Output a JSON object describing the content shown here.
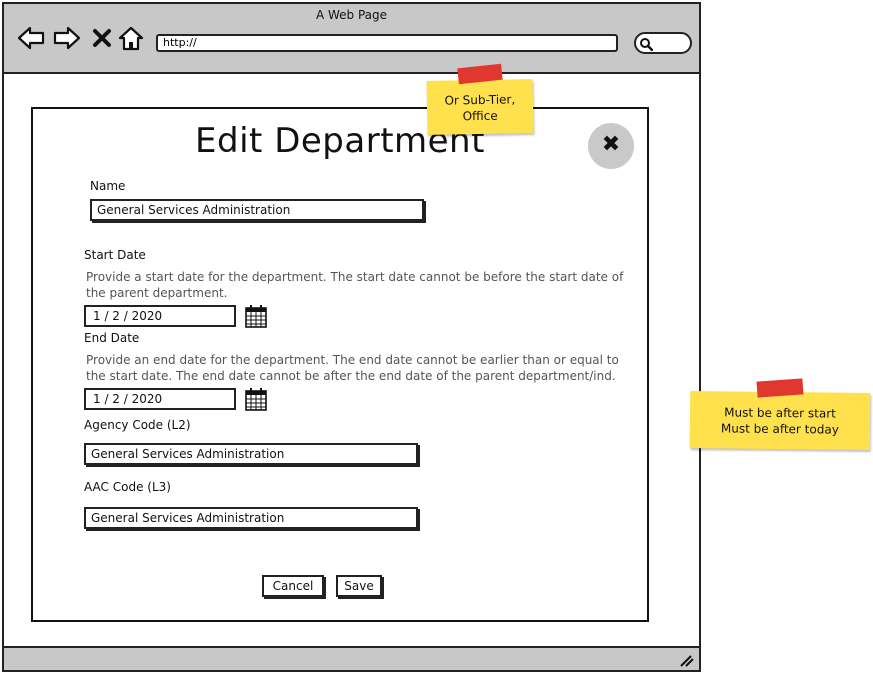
{
  "browser": {
    "title": "A Web Page",
    "url": "http://"
  },
  "modal": {
    "title": "Edit Department",
    "close_icon": "close-icon",
    "fields": {
      "name": {
        "label": "Name",
        "value": "General Services Administration"
      },
      "start_date": {
        "label": "Start Date",
        "help": "Provide a start date for the department. The start date cannot be before the start date of the parent department.",
        "value": "1 / 2 / 2020"
      },
      "end_date": {
        "label": "End Date",
        "help": "Provide an end date for the department. The end date cannot be earlier than or equal to the start date. The end date cannot be after the end date of the parent department/ind. agency",
        "value": "1 / 2 / 2020"
      },
      "agency_code": {
        "label": "Agency Code (L2)",
        "value": "General Services Administration"
      },
      "aac_code": {
        "label": "AAC Code (L3)",
        "value": "General Services Administration"
      }
    },
    "buttons": {
      "cancel": "Cancel",
      "save": "Save"
    }
  },
  "notes": {
    "sub_tier": "Or Sub-Tier,\nOffice",
    "end_date_rules": [
      "Must be after start",
      "Must be after today"
    ]
  },
  "colors": {
    "chrome": "#c8c8c8",
    "sticky": "#ffe14d",
    "tape": "#e0382f",
    "close_bg": "#c9c9c9"
  }
}
